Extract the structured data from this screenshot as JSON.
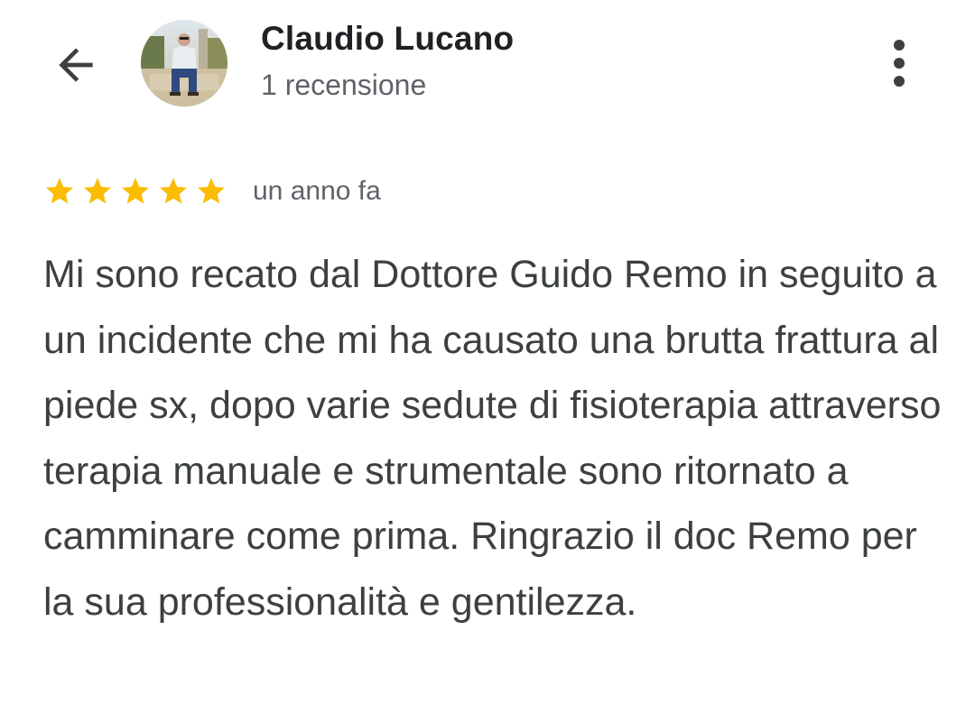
{
  "header": {
    "back_icon": "arrow-back-icon",
    "avatar_icon": "user-photo",
    "reviewer_name": "Claudio Lucano",
    "review_count": "1 recensione",
    "more_icon": "more-vert-icon"
  },
  "review": {
    "rating": 5,
    "rating_max": 5,
    "star_color": "#fbbc04",
    "date": "un anno fa",
    "text": "Mi sono recato dal Dottore Guido Remo in seguito a un incidente che mi ha causato una brutta frattura al piede sx, dopo varie sedute di fisioterapia attraverso terapia manuale e strumentale sono ritornato a camminare come prima. Ringrazio il doc Remo per la sua professionalità e gentilezza."
  }
}
